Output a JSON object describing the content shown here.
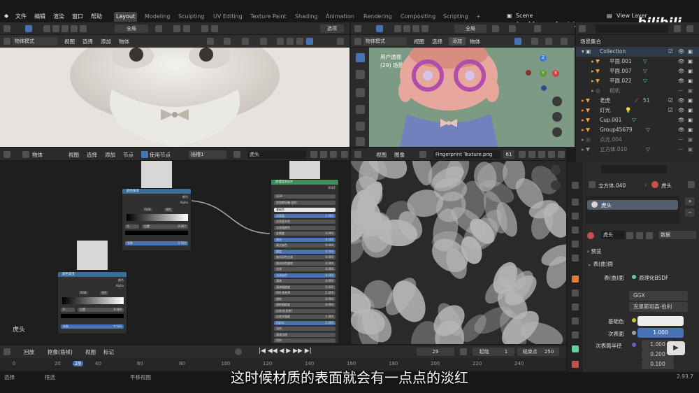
{
  "topbar": {
    "menus": [
      "文件",
      "编辑",
      "渲染",
      "窗口",
      "帮助"
    ],
    "workspaces": [
      "Layout",
      "Modeling",
      "Sculpting",
      "UV Editing",
      "Texture Paint",
      "Shading",
      "Animation",
      "Rendering",
      "Compositing",
      "Scripting"
    ],
    "add_tab": "+",
    "scene": "Scene",
    "view_layer": "View Layer"
  },
  "watermark": "超能研究所Design",
  "watermark_logo": "bilibili",
  "vp_left": {
    "global": "全局",
    "options": "选项",
    "mode": "物体模式",
    "menus": [
      "视图",
      "选择",
      "添加",
      "物体"
    ]
  },
  "vp_right": {
    "global": "全局",
    "mode": "物体模式",
    "menus": [
      "视图",
      "选择",
      "添加",
      "物体"
    ],
    "overlay1": "用户透视",
    "overlay2": "(29) 场景集合 | 立方体.040",
    "axis": {
      "x": "X",
      "y": "Y",
      "z": "Z"
    }
  },
  "outliner": {
    "title": "场景集合",
    "items": [
      {
        "name": "Collection",
        "color": "#ffffff"
      },
      {
        "name": "平面.001"
      },
      {
        "name": "平面.007"
      },
      {
        "name": "平面.022"
      },
      {
        "name": "相机"
      },
      {
        "name": "老虎"
      },
      {
        "name": "灯光"
      },
      {
        "name": "Cup.001"
      },
      {
        "name": "Group45679"
      },
      {
        "name": "点光.004"
      },
      {
        "name": "立方体.010"
      }
    ],
    "count": "51"
  },
  "node_editor": {
    "type": "物体",
    "menus": [
      "视图",
      "选择",
      "添加",
      "节点"
    ],
    "use_nodes": "使用节点",
    "slot": "插槽1",
    "material": "虎头",
    "node1": {
      "title": "颜色渐变",
      "out1": "颜色",
      "out2": "Alpha",
      "rgb": "RGB",
      "interp": "线性",
      "pos_label": "位置",
      "pos": "0.007",
      "fac": "系数",
      "fac_val": "0.500",
      "idx": "0"
    },
    "node2": {
      "title": "颜色渐变",
      "out1": "颜色",
      "out2": "Alpha",
      "rgb": "RGB",
      "interp": "线性",
      "pos_label": "位置",
      "pos": "0.000",
      "fac": "系数",
      "fac_val": "0.500",
      "idx": "0"
    },
    "bsdf": {
      "title": "原理化BSDF",
      "out": "BSDF",
      "dist": "GGX",
      "sss": "克里斯坦森-伯利",
      "rows": [
        [
          "基础色",
          ""
        ],
        [
          "次表面",
          "1.000"
        ],
        [
          "次表面半径",
          ""
        ],
        [
          "次表面颜色",
          ""
        ],
        [
          "金属度",
          "0.000"
        ],
        [
          "高光",
          "0.500"
        ],
        [
          "高光染色",
          "0.000"
        ],
        [
          "糙度",
          "0.500"
        ],
        [
          "各向异性过滤",
          "0.000"
        ],
        [
          "各向异性旋转",
          "0.000"
        ],
        [
          "光泽",
          "0.000"
        ],
        [
          "光泽染色",
          "0.500"
        ],
        [
          "清漆",
          "0.000"
        ],
        [
          "清漆粗糙度",
          "0.030"
        ],
        [
          "IOR 折射率",
          "1.450"
        ],
        [
          "透射",
          "0.000"
        ],
        [
          "透射粗糙度",
          "0.000"
        ],
        [
          "自发光(发射)",
          ""
        ],
        [
          "自发光强度",
          "1.000"
        ],
        [
          "Alpha",
          "1.000"
        ],
        [
          "法向",
          ""
        ],
        [
          "清漆法线",
          ""
        ],
        [
          "切向",
          ""
        ]
      ]
    },
    "label": "虎头"
  },
  "image_editor": {
    "menus": [
      "视图",
      "图像"
    ],
    "image": "Fingerprint Texture.png",
    "users": "61"
  },
  "props": {
    "object": "立方体.040",
    "material": "虎头",
    "slot_name": "虎头",
    "mat_name": "虎头",
    "data": "数据",
    "preview": "预览",
    "surface": "表(曲)面",
    "surface_label": "表(曲)面",
    "shader": "原理化BSDF",
    "dist": "GGX",
    "sss_method": "克里斯坦森-伯利",
    "base_color": "基础色",
    "subsurface": "次表面",
    "subsurface_val": "1.000",
    "sss_radius": "次表面半径",
    "radius": [
      "1.000",
      "0.200",
      "0.100"
    ]
  },
  "timeline": {
    "playback": "回放",
    "keying": "抠像(插帧)",
    "menus": [
      "视图",
      "标记"
    ],
    "frame": "29",
    "start_label": "起始",
    "start": "1",
    "end_label": "结束点",
    "end": "250",
    "ticks": [
      "0",
      "20",
      "29",
      "40",
      "60",
      "80",
      "100",
      "120",
      "140",
      "160",
      "180",
      "200",
      "220",
      "240"
    ]
  },
  "status": {
    "select": "选择",
    "box": "框选",
    "pan": "平移视图",
    "version": "2.93.7"
  },
  "subtitle": "这时候材质的表面就会有一点点的淡红"
}
